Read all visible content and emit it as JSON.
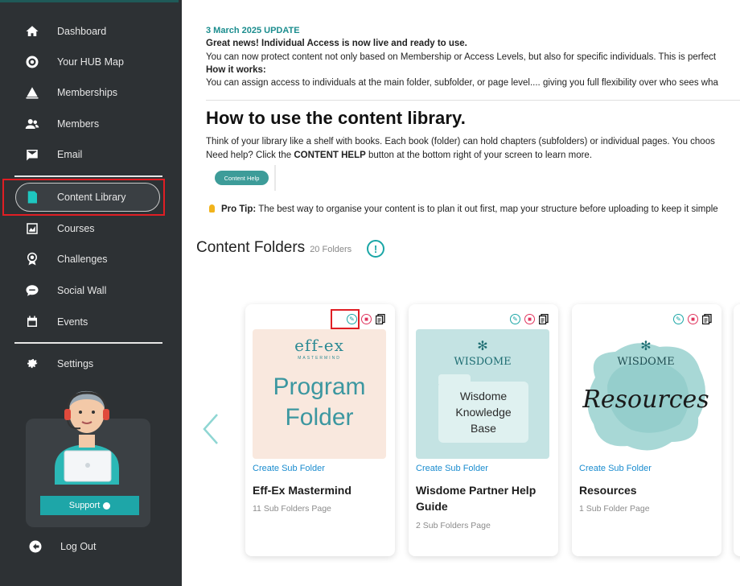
{
  "sidebar": {
    "items": [
      {
        "label": "Dashboard",
        "icon": "home-icon"
      },
      {
        "label": "Your HUB Map",
        "icon": "hub-map-icon"
      },
      {
        "label": "Memberships",
        "icon": "memberships-icon"
      },
      {
        "label": "Members",
        "icon": "members-icon"
      },
      {
        "label": "Email",
        "icon": "email-icon"
      },
      {
        "label": "Content Library",
        "icon": "content-library-icon"
      },
      {
        "label": "Courses",
        "icon": "courses-icon"
      },
      {
        "label": "Challenges",
        "icon": "challenges-icon"
      },
      {
        "label": "Social Wall",
        "icon": "social-wall-icon"
      },
      {
        "label": "Events",
        "icon": "events-icon"
      },
      {
        "label": "Settings",
        "icon": "settings-icon"
      }
    ],
    "active_item": "Content Library",
    "support_label": "Support",
    "logout_label": "Log Out"
  },
  "update": {
    "date": "3 March 2025 UPDATE",
    "headline": "Great news! Individual Access is now live and ready to use.",
    "body1": "You can now protect content not only based on Membership or Access Levels, but also for specific individuals. This is perfect",
    "how_label": "How it works:",
    "body2": "You can assign access to individuals at the main folder, subfolder, or page level.... giving you full flexibility over who sees wha"
  },
  "howto": {
    "title": "How to use the content library.",
    "line1": "Think of your library like a shelf with books. Each book (folder) can hold chapters (subfolders) or individual pages. You choos",
    "line2_prefix": "Need help? Click the ",
    "line2_bold": "CONTENT HELP",
    "line2_suffix": " button at the bottom right of your screen to learn more.",
    "help_button": "Content Help",
    "protip_label": "Pro Tip:",
    "protip_text": " The best way to organise your content is to plan it out first, map your structure before uploading to keep it simple"
  },
  "folders": {
    "title": "Content Folders",
    "count": "20 Folders",
    "info_symbol": "!",
    "cards": [
      {
        "create_label": "Create Sub Folder",
        "title": "Eff-Ex Mastermind",
        "meta": "11 Sub Folders Page",
        "img_brand": "eff-ex",
        "img_brand_sub": "MASTERMIND",
        "img_line1": "Program",
        "img_line2": "Folder"
      },
      {
        "create_label": "Create Sub Folder",
        "title": "Wisdome Partner Help Guide",
        "meta": "2 Sub Folders Page",
        "img_brand": "WISDOME",
        "img_line1": "Wisdome",
        "img_line2": "Knowledge",
        "img_line3": "Base"
      },
      {
        "create_label": "Create Sub Folder",
        "title": "Resources",
        "meta": "1 Sub Folder Page",
        "img_brand": "WISDOME",
        "img_line1": "Resources"
      }
    ]
  },
  "colors": {
    "sidebar_bg": "#2d3134",
    "accent": "#1aa6a6",
    "highlight_red": "#e01e24",
    "link_blue": "#1a8ccf"
  }
}
